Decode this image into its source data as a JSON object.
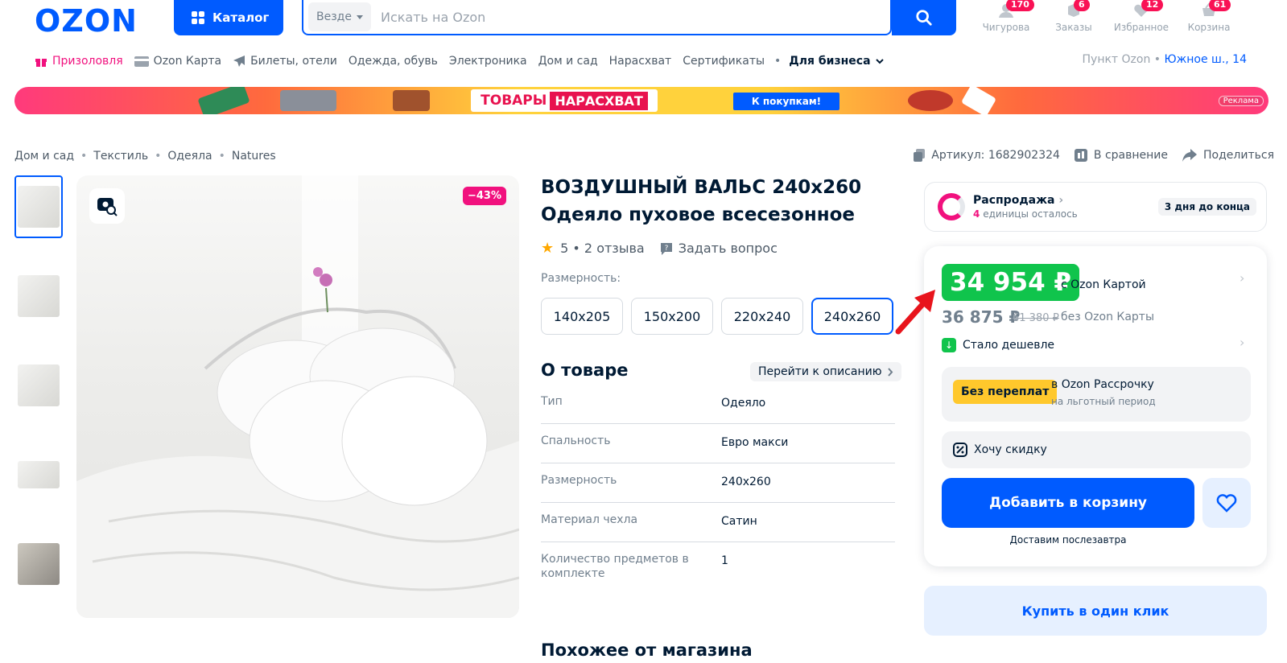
{
  "header": {
    "logo": "OZON",
    "catalog_label": "Каталог",
    "search_scope": "Везде",
    "search_placeholder": "Искать на Ozon",
    "icons": [
      {
        "label": "Чигурова",
        "badge": "170"
      },
      {
        "label": "Заказы",
        "badge": "6"
      },
      {
        "label": "Избранное",
        "badge": "12"
      },
      {
        "label": "Корзина",
        "badge": "61"
      }
    ]
  },
  "nav": {
    "items": [
      "Призоловля",
      "Ozon Карта",
      "Билеты, отели",
      "Одежда, обувь",
      "Электроника",
      "Дом и сад",
      "Нарасхват",
      "Сертификаты"
    ],
    "business": "Для бизнеса",
    "pickup_label": "Пункт Ozon",
    "pickup_address": "Южное ш., 14"
  },
  "banner": {
    "title_a": "ТОВАРЫ",
    "title_b": "НАРАСХВАТ",
    "cta": "К покупкам!",
    "ad_label": "Реклама"
  },
  "breadcrumbs": [
    "Дом и сад",
    "Текстиль",
    "Одеяла",
    "Natures"
  ],
  "top_actions": {
    "article": "Артикул: 1682902324",
    "compare": "В сравнение",
    "share": "Поделиться"
  },
  "product": {
    "discount_badge": "−43%",
    "title_line1": "ВОЗДУШНЫЙ ВАЛЬС 240х260",
    "title_line2": "Одеяло пуховое всесезонное",
    "rating": "5 • 2 отзыва",
    "ask_question": "Задать вопрос",
    "size_label": "Размерность:",
    "sizes": [
      "140х205",
      "150х200",
      "220х240",
      "240х260"
    ],
    "selected_size_index": 3,
    "about_heading": "О товаре",
    "description_link": "Перейти к описанию",
    "specs": [
      {
        "key": "Тип",
        "value": "Одеяло"
      },
      {
        "key": "Спальность",
        "value": "Евро макси"
      },
      {
        "key": "Размерность",
        "value": "240х260"
      },
      {
        "key": "Материал чехла",
        "value": "Сатин"
      },
      {
        "key": "Количество предметов в комплекте",
        "value": "1"
      }
    ],
    "similar_heading": "Похожее от магазина"
  },
  "sale": {
    "title": "Распродажа",
    "count": "4",
    "count_suffix": "единицы осталось",
    "days_left": "3 дня до конца"
  },
  "price": {
    "card_price": "34 954 ₽",
    "card_label": "с Ozon Картой",
    "regular_price": "36 875 ₽",
    "old_price": "61 380 ₽",
    "no_card_label": "без Ozon Карты",
    "cheaper_label": "Стало дешевле",
    "no_overpay_badge": "Без переплат",
    "installment_title": "в Ozon Рассрочку",
    "installment_sub": "на льготный период",
    "want_discount": "Хочу скидку",
    "add_to_cart": "Добавить в корзину",
    "delivery": "Доставим послезавтра",
    "one_click": "Купить в один клик"
  },
  "colors": {
    "brand_blue": "#005bff",
    "pink": "#f1117e",
    "green": "#10c44c",
    "yellow": "#ffc82c"
  }
}
